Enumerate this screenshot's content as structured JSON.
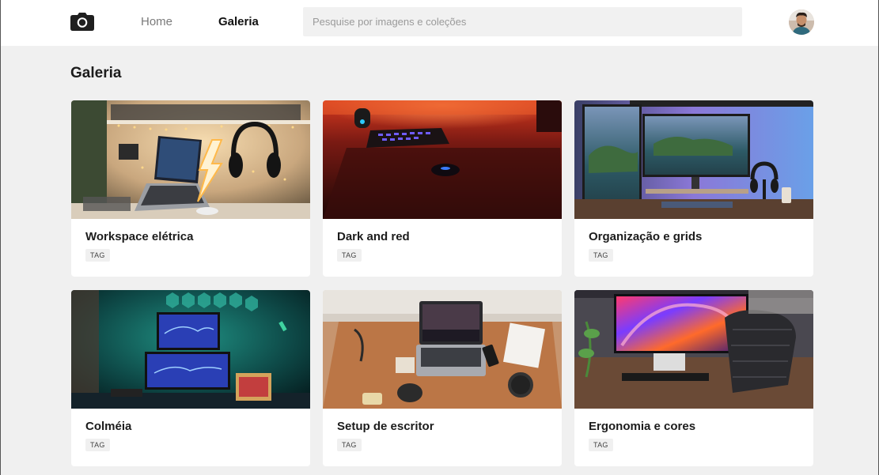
{
  "header": {
    "logo_icon": "camera-icon",
    "nav": {
      "home": "Home",
      "galeria": "Galeria"
    },
    "search_placeholder": "Pesquise por imagens e coleções",
    "avatar_icon": "user-avatar"
  },
  "page": {
    "title": "Galeria"
  },
  "colors": {
    "background": "#f0f0f0",
    "card": "#ffffff",
    "text": "#1c1c1c",
    "muted": "#7a7a7a"
  },
  "cards": [
    {
      "title": "Workspace elétrica",
      "tag": "TAG",
      "image": "desk-with-laptop-headphones-neon-bolt"
    },
    {
      "title": "Dark and red",
      "tag": "TAG",
      "image": "red-lit-keyboard-and-mouse"
    },
    {
      "title": "Organização e grids",
      "tag": "TAG",
      "image": "dual-monitor-island-wallpaper"
    },
    {
      "title": "Colméia",
      "tag": "TAG",
      "image": "stacked-monitors-hexagon-lights"
    },
    {
      "title": "Setup de escritor",
      "tag": "TAG",
      "image": "top-down-laptop-desk"
    },
    {
      "title": "Ergonomia e cores",
      "tag": "TAG",
      "image": "colorful-monitor-ergonomic-chair"
    }
  ]
}
